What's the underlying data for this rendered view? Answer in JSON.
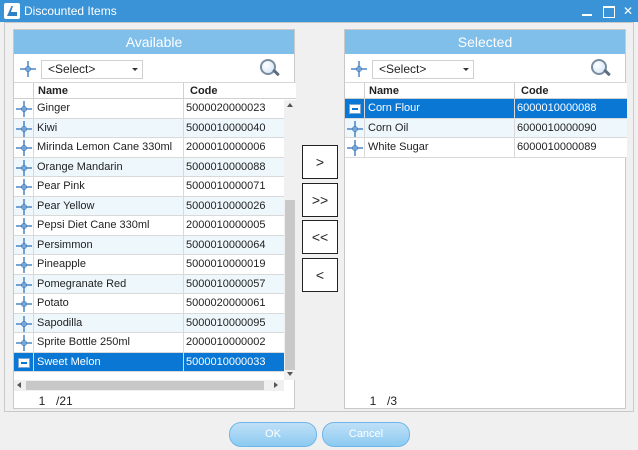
{
  "window": {
    "title": "Discounted Items"
  },
  "available": {
    "header": "Available",
    "select_value": "<Select>",
    "columns": {
      "name": "Name",
      "code": "Code"
    },
    "rows": [
      {
        "name": "Ginger",
        "code": "5000020000023",
        "selected": false
      },
      {
        "name": "Kiwi",
        "code": "5000010000040",
        "selected": false
      },
      {
        "name": "Mirinda Lemon Cane 330ml",
        "code": "2000010000006",
        "selected": false
      },
      {
        "name": "Orange Mandarin",
        "code": "5000010000088",
        "selected": false
      },
      {
        "name": "Pear Pink",
        "code": "5000010000071",
        "selected": false
      },
      {
        "name": "Pear Yellow",
        "code": "5000010000026",
        "selected": false
      },
      {
        "name": "Pepsi Diet Cane 330ml",
        "code": "2000010000005",
        "selected": false
      },
      {
        "name": "Persimmon",
        "code": "5000010000064",
        "selected": false
      },
      {
        "name": "Pineapple",
        "code": "5000010000019",
        "selected": false
      },
      {
        "name": "Pomegranate Red",
        "code": "5000010000057",
        "selected": false
      },
      {
        "name": "Potato",
        "code": "5000020000061",
        "selected": false
      },
      {
        "name": "Sapodilla",
        "code": "5000010000095",
        "selected": false
      },
      {
        "name": "Sprite Bottle 250ml",
        "code": "2000010000002",
        "selected": false
      },
      {
        "name": "Sweet Melon",
        "code": "5000010000033",
        "selected": true
      }
    ],
    "pager": {
      "page": "1",
      "total": "/21"
    }
  },
  "selected": {
    "header": "Selected",
    "select_value": "<Select>",
    "columns": {
      "name": "Name",
      "code": "Code"
    },
    "rows": [
      {
        "name": "Corn Flour",
        "code": "6000010000088",
        "selected": true
      },
      {
        "name": "Corn Oil",
        "code": "6000010000090",
        "selected": false
      },
      {
        "name": "White Sugar",
        "code": "6000010000089",
        "selected": false
      }
    ],
    "pager": {
      "page": "1",
      "total": "/3"
    }
  },
  "transfer": {
    "add_one": ">",
    "add_all": ">>",
    "remove_all": "<<",
    "remove_one": "<"
  },
  "footer": {
    "ok": "OK",
    "cancel": "Cancel"
  },
  "colors": {
    "titlebar": "#3a93d6",
    "panel_header": "#7fbfea",
    "selection": "#0a77d5",
    "row_alt": "#eef8fc"
  }
}
